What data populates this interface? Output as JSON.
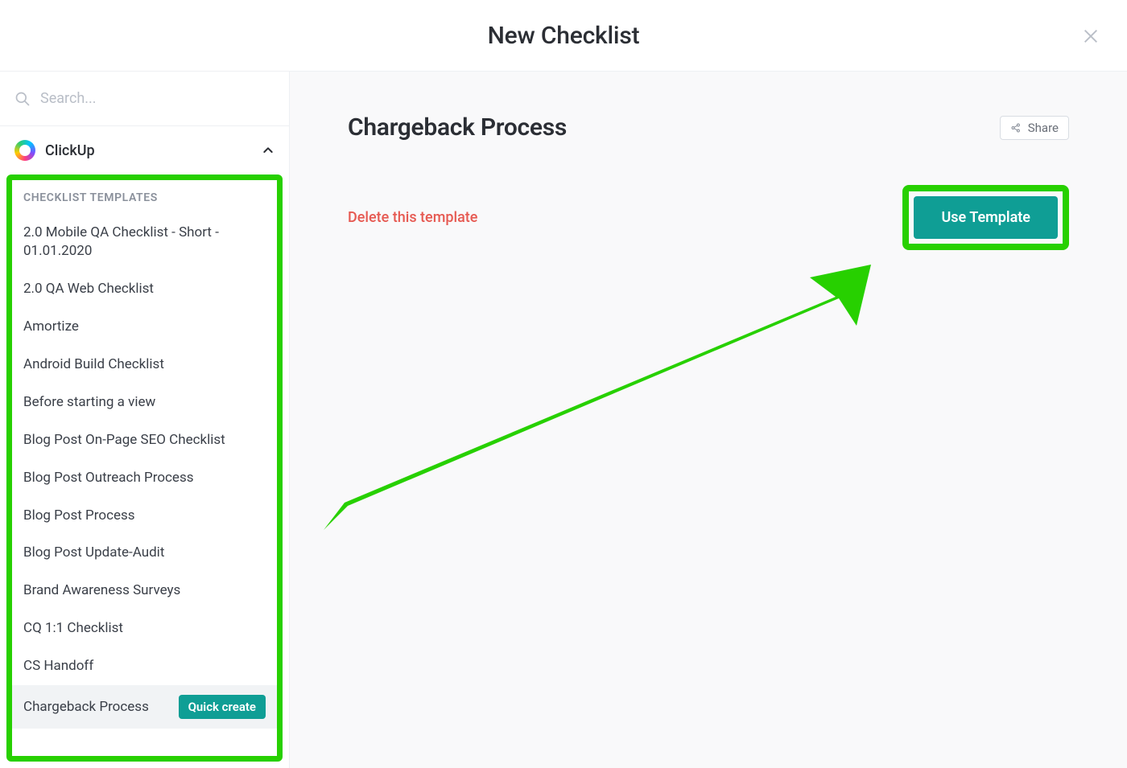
{
  "modal": {
    "title": "New Checklist",
    "search_placeholder": "Search...",
    "workspace_name": "ClickUp"
  },
  "templates_heading": "CHECKLIST TEMPLATES",
  "templates": [
    {
      "label": "2.0 Mobile QA Checklist - Short - 01.01.2020"
    },
    {
      "label": "2.0 QA Web Checklist"
    },
    {
      "label": "Amortize"
    },
    {
      "label": "Android Build Checklist"
    },
    {
      "label": "Before starting a view"
    },
    {
      "label": "Blog Post On-Page SEO Checklist"
    },
    {
      "label": "Blog Post Outreach Process"
    },
    {
      "label": "Blog Post Process"
    },
    {
      "label": "Blog Post Update-Audit"
    },
    {
      "label": "Brand Awareness Surveys"
    },
    {
      "label": "CQ 1:1 Checklist"
    },
    {
      "label": "CS Handoff"
    },
    {
      "label": "Chargeback Process",
      "selected": true
    }
  ],
  "quick_create_label": "Quick create",
  "main": {
    "title": "Chargeback Process",
    "share_label": "Share",
    "delete_label": "Delete this template",
    "use_template_label": "Use Template"
  },
  "colors": {
    "accent_teal": "#0f9e95",
    "highlight_green": "#27d000",
    "danger": "#e65a52"
  }
}
